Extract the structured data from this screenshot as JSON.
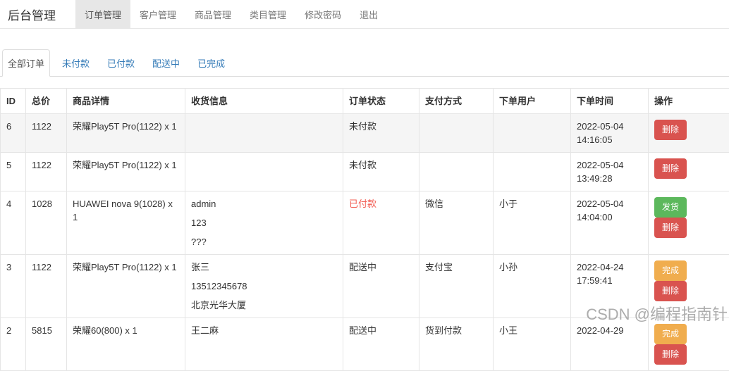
{
  "navbar": {
    "brand": "后台管理",
    "items": [
      {
        "key": "order-management",
        "label": "订单管理",
        "active": true
      },
      {
        "key": "customer-management",
        "label": "客户管理",
        "active": false
      },
      {
        "key": "product-management",
        "label": "商品管理",
        "active": false
      },
      {
        "key": "category-management",
        "label": "类目管理",
        "active": false
      },
      {
        "key": "change-password",
        "label": "修改密码",
        "active": false
      },
      {
        "key": "logout",
        "label": "退出",
        "active": false
      }
    ]
  },
  "tabs": [
    {
      "key": "all-orders",
      "label": "全部订单",
      "active": true
    },
    {
      "key": "unpaid",
      "label": "未付款",
      "active": false
    },
    {
      "key": "paid",
      "label": "已付款",
      "active": false
    },
    {
      "key": "shipping",
      "label": "配送中",
      "active": false
    },
    {
      "key": "completed",
      "label": "已完成",
      "active": false
    }
  ],
  "table": {
    "headers": [
      "ID",
      "总价",
      "商品详情",
      "收货信息",
      "订单状态",
      "支付方式",
      "下单用户",
      "下单时间",
      "操作"
    ],
    "rows": [
      {
        "id": "6",
        "total": "1122",
        "product": "荣耀Play5T Pro(1122) x 1",
        "shipping": [],
        "status": "未付款",
        "status_key": "unpaid",
        "payment": "",
        "user": "",
        "time": "2022-05-04 14:16:05",
        "hovered": true,
        "actions": [
          {
            "key": "delete",
            "label": "删除",
            "type": "danger"
          }
        ]
      },
      {
        "id": "5",
        "total": "1122",
        "product": "荣耀Play5T Pro(1122) x 1",
        "shipping": [],
        "status": "未付款",
        "status_key": "unpaid",
        "payment": "",
        "user": "",
        "time": "2022-05-04 13:49:28",
        "hovered": false,
        "actions": [
          {
            "key": "delete",
            "label": "删除",
            "type": "danger"
          }
        ]
      },
      {
        "id": "4",
        "total": "1028",
        "product": "HUAWEI nova 9(1028) x 1",
        "shipping": [
          "admin",
          "123",
          "???"
        ],
        "status": "已付款",
        "status_key": "paid",
        "payment": "微信",
        "user": "小于",
        "time": "2022-05-04 14:04:00",
        "hovered": false,
        "actions": [
          {
            "key": "ship",
            "label": "发货",
            "type": "success"
          },
          {
            "key": "delete",
            "label": "删除",
            "type": "danger"
          }
        ]
      },
      {
        "id": "3",
        "total": "1122",
        "product": "荣耀Play5T Pro(1122) x 1",
        "shipping": [
          "张三",
          "13512345678",
          "北京光华大厦"
        ],
        "status": "配送中",
        "status_key": "shipping",
        "payment": "支付宝",
        "user": "小孙",
        "time": "2022-04-24 17:59:41",
        "hovered": false,
        "actions": [
          {
            "key": "complete",
            "label": "完成",
            "type": "warning"
          },
          {
            "key": "delete",
            "label": "删除",
            "type": "danger"
          }
        ]
      },
      {
        "id": "2",
        "total": "5815",
        "product": "荣耀60(800) x 1",
        "shipping": [
          "王二麻"
        ],
        "status": "配送中",
        "status_key": "shipping",
        "payment": "货到付款",
        "user": "小王",
        "time": "2022-04-29",
        "hovered": false,
        "actions": [
          {
            "key": "complete",
            "label": "完成",
            "type": "warning"
          },
          {
            "key": "delete",
            "label": "删除",
            "type": "danger"
          }
        ]
      }
    ]
  },
  "watermark": {
    "text": "CSDN @编程指南针"
  },
  "colors": {
    "link": "#337ab7",
    "danger": "#d9534f",
    "success": "#5cb85c",
    "warning": "#f0ad4e",
    "paid_status_text": "#f25c52",
    "active_nav_bg": "#e7e7e7",
    "hover_row_bg": "#f5f5f5",
    "border": "#e5e5e5",
    "watermark_text": "#a5a5a5"
  }
}
